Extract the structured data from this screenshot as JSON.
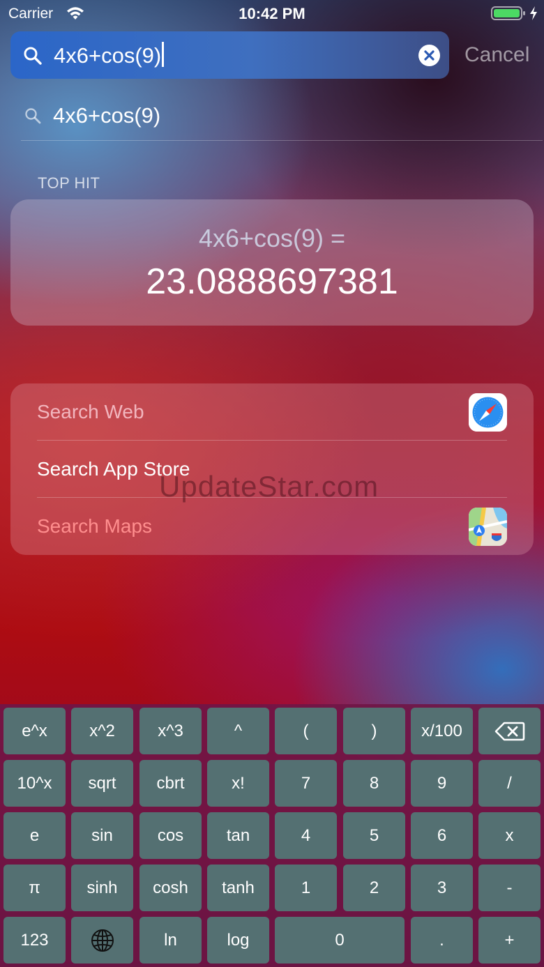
{
  "status_bar": {
    "carrier": "Carrier",
    "time": "10:42 PM"
  },
  "search": {
    "query": "4x6+cos(9)",
    "cancel_label": "Cancel"
  },
  "suggestion": {
    "text": "4x6+cos(9)"
  },
  "top_hit": {
    "header": "TOP HIT",
    "expression": "4x6+cos(9) =",
    "result": "23.0888697381"
  },
  "actions": [
    {
      "label": "Search Web",
      "color": "#f2b6be",
      "icon": "safari-icon"
    },
    {
      "label": "Search App Store",
      "color": "#ffffff",
      "icon": ""
    },
    {
      "label": "Search Maps",
      "color": "#ff8e8e",
      "icon": "maps-icon"
    }
  ],
  "watermark": "UpdateStar.com",
  "keyboard": {
    "rows": [
      [
        "e^x",
        "x^2",
        "x^3",
        "^",
        "(",
        ")",
        "x/100",
        "backspace"
      ],
      [
        "10^x",
        "sqrt",
        "cbrt",
        "x!",
        "7",
        "8",
        "9",
        "/"
      ],
      [
        "e",
        "sin",
        "cos",
        "tan",
        "4",
        "5",
        "6",
        "x"
      ],
      [
        "π",
        "sinh",
        "cosh",
        "tanh",
        "1",
        "2",
        "3",
        "-"
      ],
      [
        "123",
        "globe",
        "ln",
        "log",
        "0",
        ".",
        "+"
      ]
    ]
  }
}
